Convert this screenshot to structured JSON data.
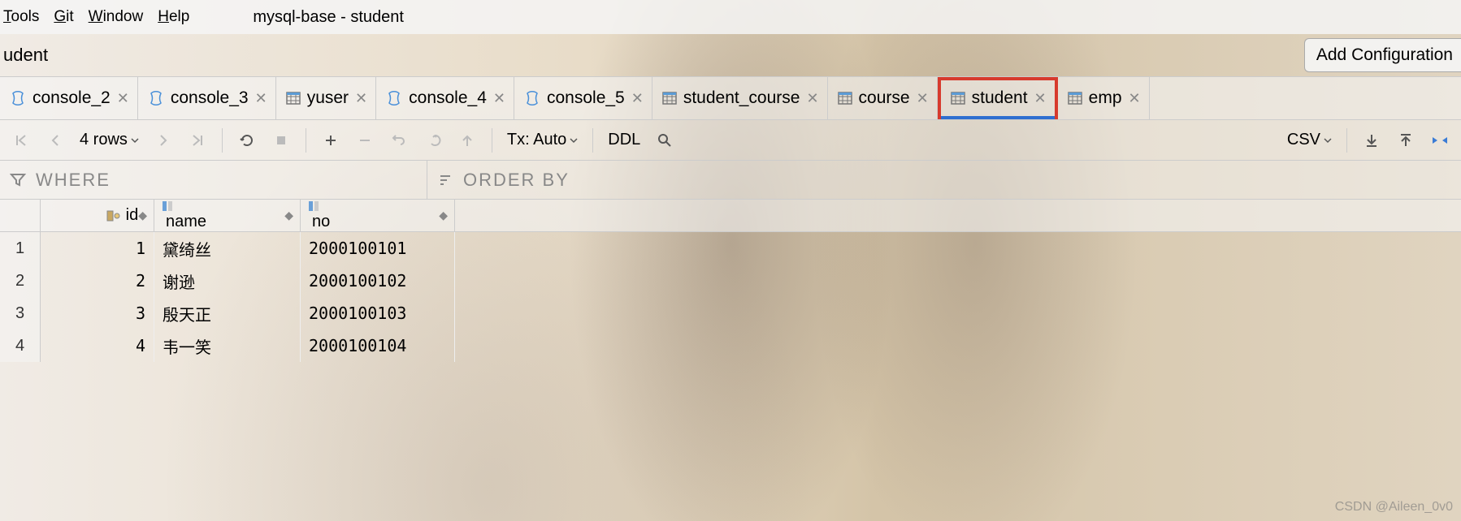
{
  "menu": {
    "items": [
      "Tools",
      "Git",
      "Window",
      "Help"
    ],
    "underlines": [
      "T",
      "G",
      "W",
      "H"
    ]
  },
  "window_title": "mysql-base - student",
  "breadcrumb": "udent",
  "add_config": "Add Configuration",
  "tabs": [
    {
      "label": "console_2",
      "type": "sql"
    },
    {
      "label": "console_3",
      "type": "sql"
    },
    {
      "label": "yuser",
      "type": "table"
    },
    {
      "label": "console_4",
      "type": "sql"
    },
    {
      "label": "console_5",
      "type": "sql"
    },
    {
      "label": "student_course",
      "type": "table"
    },
    {
      "label": "course",
      "type": "table"
    },
    {
      "label": "student",
      "type": "table",
      "active": true
    },
    {
      "label": "emp",
      "type": "table"
    }
  ],
  "toolbar": {
    "rows_label": "4 rows",
    "tx_label": "Tx: Auto",
    "ddl_label": "DDL",
    "csv_label": "CSV"
  },
  "filter": {
    "where": "WHERE",
    "order": "ORDER BY"
  },
  "columns": [
    {
      "name": "id",
      "pk": true
    },
    {
      "name": "name",
      "pk": false
    },
    {
      "name": "no",
      "pk": false
    }
  ],
  "rows": [
    {
      "n": 1,
      "id": 1,
      "name": "黛绮丝",
      "no": "2000100101"
    },
    {
      "n": 2,
      "id": 2,
      "name": "谢逊",
      "no": "2000100102"
    },
    {
      "n": 3,
      "id": 3,
      "name": "殷天正",
      "no": "2000100103"
    },
    {
      "n": 4,
      "id": 4,
      "name": "韦一笑",
      "no": "2000100104"
    }
  ],
  "watermark": "CSDN @Aileen_0v0"
}
